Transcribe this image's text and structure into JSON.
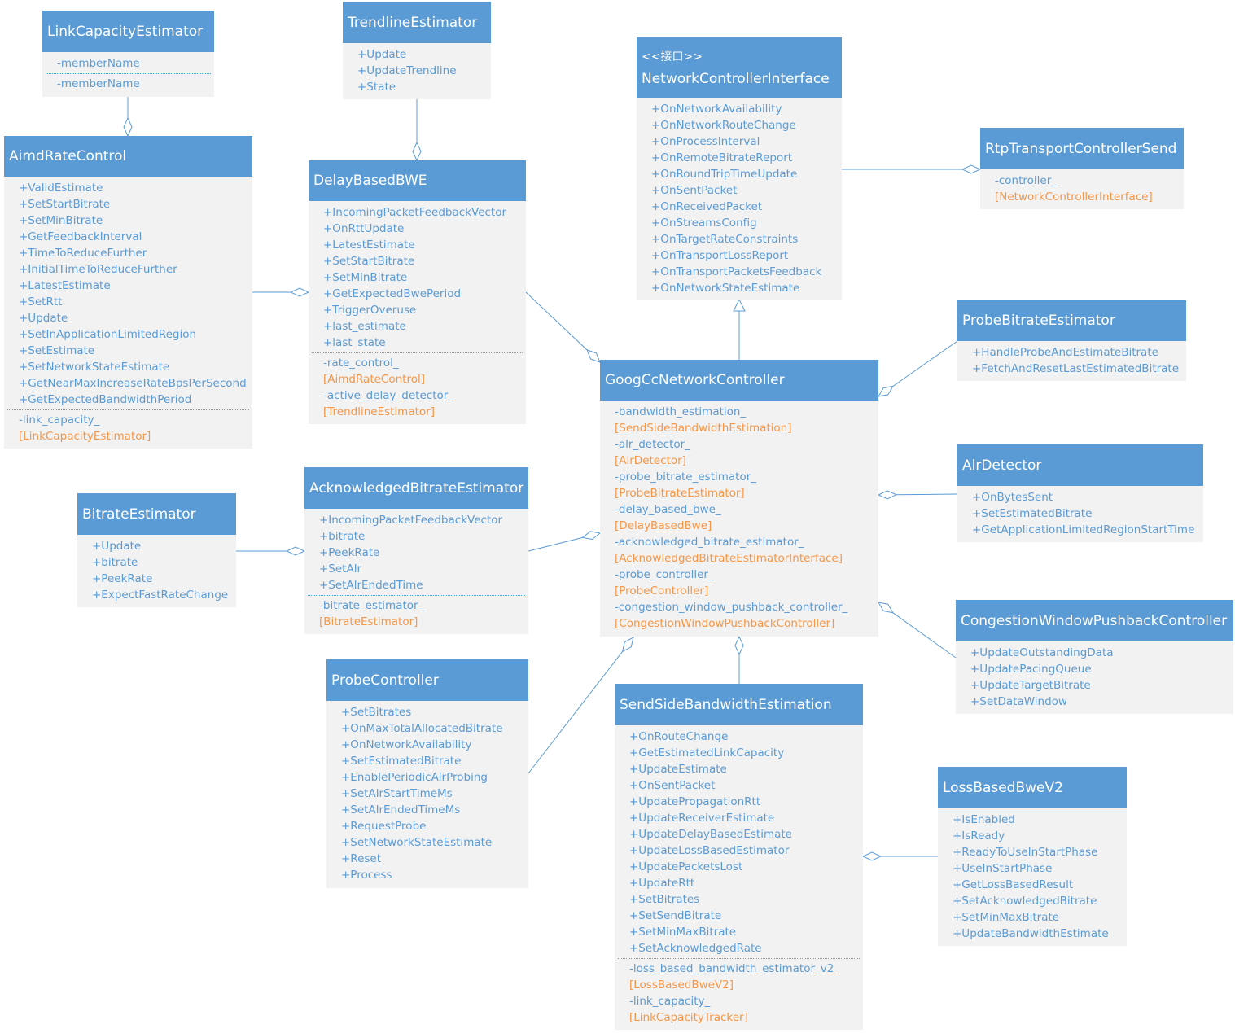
{
  "colors": {
    "header": "#5b9bd5",
    "body": "#f2f2f2",
    "text": "#5b9bd5",
    "type_text": "#f79646",
    "line": "#5b9bd5"
  },
  "classes": [
    {
      "id": "link_capacity_estimator",
      "name": "LinkCapacityEstimator",
      "methods": [],
      "members": [
        {
          "name": "-memberName"
        },
        {
          "name": "-memberName"
        }
      ],
      "split_members": true
    },
    {
      "id": "trendline_estimator",
      "name": "TrendlineEstimator",
      "methods": [
        "+Update",
        "+UpdateTrendline",
        "+State"
      ],
      "members": []
    },
    {
      "id": "network_controller_interface",
      "stereotype": "<<接口>>",
      "name": "NetworkControllerInterface",
      "methods": [
        "+OnNetworkAvailability",
        "+OnNetworkRouteChange",
        "+OnProcessInterval",
        "+OnRemoteBitrateReport",
        "+OnRoundTripTimeUpdate",
        "+OnSentPacket",
        "+OnReceivedPacket",
        "+OnStreamsConfig",
        "+OnTargetRateConstraints",
        "+OnTransportLossReport",
        "+OnTransportPacketsFeedback",
        "+OnNetworkStateEstimate"
      ],
      "members": []
    },
    {
      "id": "rtp_transport_controller_send",
      "name": "RtpTransportControllerSend",
      "methods": [],
      "members": [
        {
          "name": "-controller_",
          "type": "[NetworkControllerInterface]"
        }
      ]
    },
    {
      "id": "aimd_rate_control",
      "name": "AimdRateControl",
      "methods": [
        "+ValidEstimate",
        "+SetStartBitrate",
        "+SetMinBitrate",
        "+GetFeedbackInterval",
        "+TimeToReduceFurther",
        "+InitialTimeToReduceFurther",
        "+LatestEstimate",
        "+SetRtt",
        "+Update",
        "+SetInApplicationLimitedRegion",
        "+SetEstimate",
        "+SetNetworkStateEstimate",
        "+GetNearMaxIncreaseRateBpsPerSecond",
        "+GetExpectedBandwidthPeriod"
      ],
      "members": [
        {
          "name": "-link_capacity_",
          "type": "[LinkCapacityEstimator]"
        }
      ]
    },
    {
      "id": "delay_based_bwe",
      "name": "DelayBasedBWE",
      "methods": [
        "+IncomingPacketFeedbackVector",
        "+OnRttUpdate",
        "+LatestEstimate",
        "+SetStartBitrate",
        "+SetMinBitrate",
        "+GetExpectedBwePeriod",
        "+TriggerOveruse",
        "+last_estimate",
        "+last_state"
      ],
      "members": [
        {
          "name": "-rate_control_",
          "type": "[AimdRateControl]"
        },
        {
          "name": "-active_delay_detector_",
          "type": "[TrendlineEstimator]"
        }
      ]
    },
    {
      "id": "probe_bitrate_estimator",
      "name": "ProbeBitrateEstimator",
      "methods": [
        "+HandleProbeAndEstimateBitrate",
        "+FetchAndResetLastEstimatedBitrate"
      ],
      "members": []
    },
    {
      "id": "goog_cc_network_controller",
      "name": "GoogCcNetworkController",
      "methods": [],
      "members": [
        {
          "name": "-bandwidth_estimation_",
          "type": "[SendSideBandwidthEstimation]"
        },
        {
          "name": "-alr_detector_",
          "type": "[AlrDetector]"
        },
        {
          "name": "-probe_bitrate_estimator_",
          "type": "[ProbeBitrateEstimator]"
        },
        {
          "name": "-delay_based_bwe_",
          "type": "[DelayBasedBwe]"
        },
        {
          "name": "-acknowledged_bitrate_estimator_",
          "type": "[AcknowledgedBitrateEstimatorInterface]"
        },
        {
          "name": "-probe_controller_",
          "type": "[ProbeController]"
        },
        {
          "name": "-congestion_window_pushback_controller_",
          "type": "[CongestionWindowPushbackController]"
        }
      ]
    },
    {
      "id": "alr_detector",
      "name": "AlrDetector",
      "methods": [
        "+OnBytesSent",
        "+SetEstimatedBitrate",
        "+GetApplicationLimitedRegionStartTime"
      ],
      "members": []
    },
    {
      "id": "bitrate_estimator",
      "name": "BitrateEstimator",
      "methods": [
        "+Update",
        "+bitrate",
        "+PeekRate",
        "+ExpectFastRateChange"
      ],
      "members": []
    },
    {
      "id": "acknowledged_bitrate_estimator",
      "name": "AcknowledgedBitrateEstimator",
      "methods": [
        "+IncomingPacketFeedbackVector",
        "+bitrate",
        "+PeekRate",
        "+SetAlr",
        "+SetAlrEndedTime"
      ],
      "members": [
        {
          "name": "-bitrate_estimator_",
          "type": "[BitrateEstimator]"
        }
      ]
    },
    {
      "id": "congestion_window_pushback_controller",
      "name": "CongestionWindowPushbackController",
      "methods": [
        "+UpdateOutstandingData",
        "+UpdatePacingQueue",
        "+UpdateTargetBitrate",
        "+SetDataWindow"
      ],
      "members": []
    },
    {
      "id": "probe_controller",
      "name": "ProbeController",
      "methods": [
        "+SetBitrates",
        "+OnMaxTotalAllocatedBitrate",
        "+OnNetworkAvailability",
        "+SetEstimatedBitrate",
        "+EnablePeriodicAlrProbing",
        "+SetAlrStartTimeMs",
        "+SetAlrEndedTimeMs",
        "+RequestProbe",
        "+SetNetworkStateEstimate",
        "+Reset",
        "+Process"
      ],
      "members": []
    },
    {
      "id": "send_side_bandwidth_estimation",
      "name": "SendSideBandwidthEstimation",
      "methods": [
        "+OnRouteChange",
        "+GetEstimatedLinkCapacity",
        "+UpdateEstimate",
        "+OnSentPacket",
        "+UpdatePropagationRtt",
        "+UpdateReceiverEstimate",
        "+UpdateDelayBasedEstimate",
        "+UpdateLossBasedEstimator",
        "+UpdatePacketsLost",
        "+UpdateRtt",
        "+SetBitrates",
        "+SetSendBitrate",
        "+SetMinMaxBitrate",
        "+SetAcknowledgedRate"
      ],
      "members": [
        {
          "name": "-loss_based_bandwidth_estimator_v2_",
          "type": "[LossBasedBweV2]"
        },
        {
          "name": "-link_capacity_",
          "type": "[LinkCapacityTracker]"
        }
      ]
    },
    {
      "id": "loss_based_bwe_v2",
      "name": "LossBasedBweV2",
      "methods": [
        "+IsEnabled",
        "+IsReady",
        "+ReadyToUseInStartPhase",
        "+UseInStartPhase",
        "+GetLossBasedResult",
        "+SetAcknowledgedBitrate",
        "+SetMinMaxBitrate",
        "+UpdateBandwidthEstimate"
      ],
      "members": []
    }
  ],
  "relations": [
    {
      "whole": "aimd_rate_control",
      "part": "link_capacity_estimator",
      "type": "aggregation"
    },
    {
      "whole": "delay_based_bwe",
      "part": "trendline_estimator",
      "type": "aggregation"
    },
    {
      "whole": "delay_based_bwe",
      "part": "aimd_rate_control",
      "type": "aggregation"
    },
    {
      "whole": "goog_cc_network_controller",
      "part": "delay_based_bwe",
      "type": "aggregation"
    },
    {
      "whole": "network_controller_interface",
      "part": "goog_cc_network_controller",
      "type": "realization"
    },
    {
      "whole": "rtp_transport_controller_send",
      "part": "network_controller_interface",
      "type": "aggregation"
    },
    {
      "whole": "goog_cc_network_controller",
      "part": "probe_bitrate_estimator",
      "type": "aggregation"
    },
    {
      "whole": "goog_cc_network_controller",
      "part": "alr_detector",
      "type": "aggregation"
    },
    {
      "whole": "acknowledged_bitrate_estimator",
      "part": "bitrate_estimator",
      "type": "aggregation"
    },
    {
      "whole": "goog_cc_network_controller",
      "part": "acknowledged_bitrate_estimator",
      "type": "aggregation"
    },
    {
      "whole": "goog_cc_network_controller",
      "part": "congestion_window_pushback_controller",
      "type": "aggregation"
    },
    {
      "whole": "goog_cc_network_controller",
      "part": "probe_controller",
      "type": "aggregation"
    },
    {
      "whole": "goog_cc_network_controller",
      "part": "send_side_bandwidth_estimation",
      "type": "aggregation"
    },
    {
      "whole": "send_side_bandwidth_estimation",
      "part": "loss_based_bwe_v2",
      "type": "aggregation"
    }
  ]
}
